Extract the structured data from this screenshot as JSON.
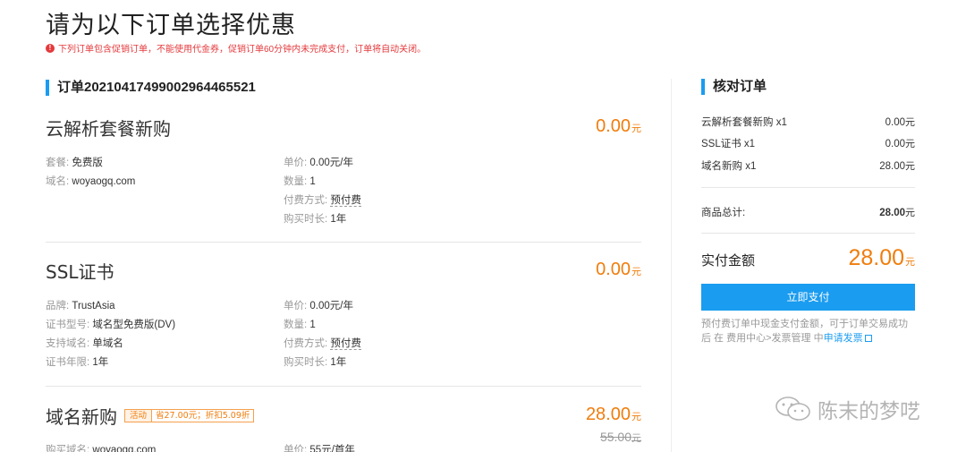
{
  "page": {
    "title": "请为以下订单选择优惠",
    "notice": "下列订单包含促销订单，不能使用代金券，促销订单60分钟内未完成支付，订单将自动关闭。"
  },
  "order": {
    "number": "订单20210417499002964465521",
    "items": [
      {
        "name": "云解析套餐新购",
        "price": "0.00",
        "unit": "元",
        "left": [
          {
            "k": "套餐:",
            "v": "免费版"
          },
          {
            "k": "域名:",
            "v": "woyaogq.com"
          }
        ],
        "right": [
          {
            "k": "单价:",
            "v": "0.00元/年"
          },
          {
            "k": "数量:",
            "v": "1"
          },
          {
            "k": "付费方式:",
            "v": "预付费"
          },
          {
            "k": "购买时长:",
            "v": "1年"
          }
        ]
      },
      {
        "name": "SSL证书",
        "price": "0.00",
        "unit": "元",
        "left": [
          {
            "k": "品牌:",
            "v": "TrustAsia"
          },
          {
            "k": "证书型号:",
            "v": "域名型免费版(DV)"
          },
          {
            "k": "支持域名:",
            "v": "单域名"
          },
          {
            "k": "证书年限:",
            "v": "1年"
          }
        ],
        "right": [
          {
            "k": "单价:",
            "v": "0.00元/年"
          },
          {
            "k": "数量:",
            "v": "1"
          },
          {
            "k": "付费方式:",
            "v": "预付费"
          },
          {
            "k": "购买时长:",
            "v": "1年"
          }
        ]
      },
      {
        "name": "域名新购",
        "promo_tag": "活动",
        "promo_text": "省27.00元；折扣5.09折",
        "price": "28.00",
        "unit": "元",
        "orig_price": "55.00",
        "left": [
          {
            "k": "购买域名:",
            "v": "woyaogq.com"
          }
        ],
        "right": [
          {
            "k": "单价:",
            "v": "55元/首年"
          }
        ]
      }
    ]
  },
  "summary": {
    "title": "核对订单",
    "lines": [
      {
        "label": "云解析套餐新购 x1",
        "value": "0.00",
        "unit": "元"
      },
      {
        "label": "SSL证书 x1",
        "value": "0.00",
        "unit": "元"
      },
      {
        "label": "域名新购 x1",
        "value": "28.00",
        "unit": "元"
      }
    ],
    "subtotal_label": "商品总计:",
    "subtotal_value": "28.00",
    "subtotal_unit": "元",
    "total_label": "实付金额",
    "total_value": "28.00",
    "total_unit": "元",
    "pay_button": "立即支付",
    "note_pre": "预付费订单中现金支付金额，可于订单交易成功后 在 费用中心>发票管理 中",
    "note_link": "申请发票"
  },
  "watermark": {
    "text": "陈末的梦呓"
  },
  "colors": {
    "accent": "#1a9cf0",
    "price": "#f07d0c",
    "warning": "#e4393c"
  }
}
